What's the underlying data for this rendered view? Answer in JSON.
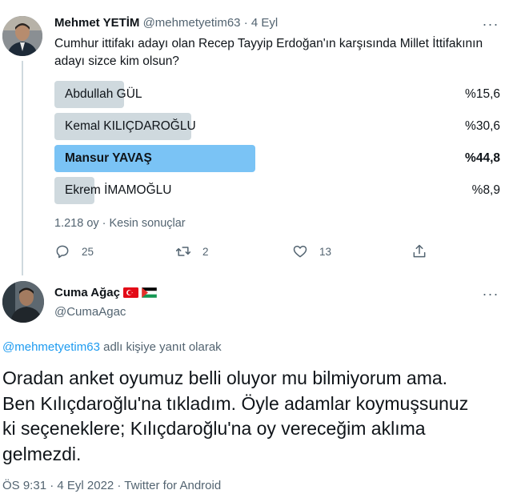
{
  "tweet": {
    "author_name": "Mehmet YETİM",
    "author_handle": "@mehmetyetim63",
    "separator": "·",
    "date": "4 Eyl",
    "more": "···",
    "text": "Cumhur ittifakı adayı olan Recep Tayyip Erdoğan'ın karşısında Millet İttifakının adayı sizce kim olsun?",
    "poll": {
      "options": [
        {
          "label": "Abdullah GÜL",
          "percent_text": "%15,6",
          "percent": 15.6,
          "winner": false
        },
        {
          "label": "Kemal KILIÇDAROĞLU",
          "percent_text": "%30,6",
          "percent": 30.6,
          "winner": false
        },
        {
          "label": "Mansur YAVAŞ",
          "percent_text": "%44,8",
          "percent": 44.8,
          "winner": true
        },
        {
          "label": "Ekrem İMAMOĞLU",
          "percent_text": "%8,9",
          "percent": 8.9,
          "winner": false
        }
      ],
      "meta": "1.218 oy · Kesin sonuçlar"
    },
    "actions": {
      "replies": "25",
      "retweets": "2",
      "likes": "13"
    }
  },
  "reply": {
    "author_name": "Cuma Ağaç",
    "author_handle": "@CumaAgac",
    "more": "···",
    "reply_to_handle": "@mehmetyetim63",
    "reply_to_suffix": " adlı kişiye yanıt olarak",
    "text": "Oradan anket oyumuz belli oluyor mu bilmiyorum ama. Ben Kılıçdaroğlu'na tıkladım. Öyle adamlar koymuşsunuz ki seçeneklere; Kılıçdaroğlu'na oy vereceğim aklıma gelmezdi.",
    "footer": "ÖS 9:31 · 4 Eyl 2022 · Twitter for Android"
  },
  "colors": {
    "accent": "#1d9bf0",
    "poll_bar": "#cfd9de",
    "poll_winner_bar": "#7ac3f5",
    "secondary_text": "#536471"
  },
  "icons": [
    "reply-icon",
    "retweet-icon",
    "like-icon",
    "share-icon",
    "turkey-flag-icon",
    "palestine-flag-icon"
  ]
}
